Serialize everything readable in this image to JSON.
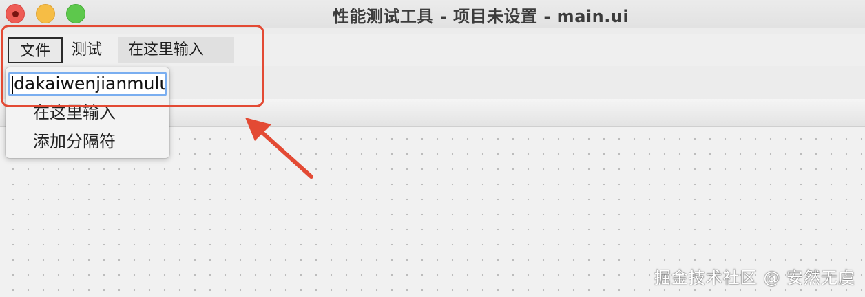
{
  "window": {
    "title": "性能测试工具 - 项目未设置 - main.ui"
  },
  "menubar": {
    "items": [
      {
        "label": "文件"
      },
      {
        "label": "测试"
      },
      {
        "label": "在这里输入"
      }
    ]
  },
  "dropdown": {
    "input_value": "dakaiwenjianmulu",
    "items": [
      {
        "label": "在这里输入"
      },
      {
        "label": "添加分隔符"
      }
    ]
  },
  "annotation": {
    "highlight_color": "#e34a34"
  },
  "watermark": {
    "text": "掘金技术社区 @ 安然无虞"
  }
}
